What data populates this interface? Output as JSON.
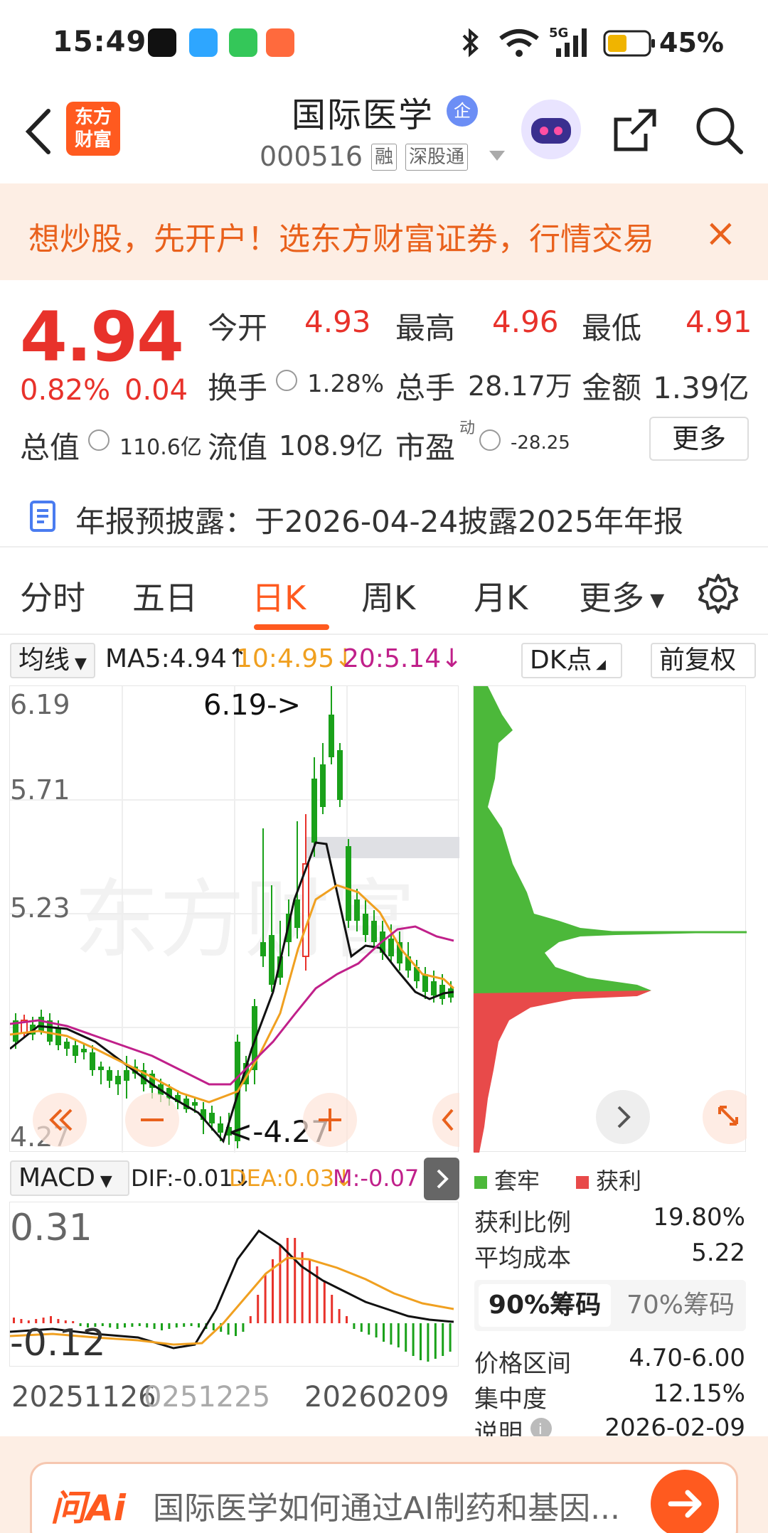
{
  "status_bar": {
    "time": "15:49",
    "battery": "45%"
  },
  "header": {
    "name": "国际医学",
    "badge": "企",
    "code": "000516",
    "tags": [
      "融",
      "深股通"
    ],
    "logo": "东方财富"
  },
  "banner": {
    "text": "想炒股，先开户！选东方财富证券，行情交易",
    "close": "×"
  },
  "quote": {
    "price": "4.94",
    "change_pct": "0.82%",
    "change": "0.04",
    "open_label": "今开",
    "open": "4.93",
    "high_label": "最高",
    "high": "4.96",
    "low_label": "最低",
    "low": "4.91",
    "turnover_label": "换手",
    "turnover": "1.28%",
    "volume_label": "总手",
    "volume": "28.17万",
    "amount_label": "金额",
    "amount": "1.39亿",
    "mktcap_label": "总值",
    "mktcap": "110.6亿",
    "float_label": "流值",
    "float": "108.9亿",
    "pe_label": "市盈",
    "pe_sup": "动",
    "pe": "-28.25",
    "more": "更多"
  },
  "notice": {
    "text": "年报预披露：于2026-04-24披露2025年年报"
  },
  "tabs": [
    "分时",
    "五日",
    "日K",
    "周K",
    "月K",
    "更多"
  ],
  "indicators": {
    "ma_select": "均线",
    "ma5": "MA5:4.94↑",
    "ma10": "10:4.95↓",
    "ma20": "20:5.14↓",
    "dk": "DK点",
    "adjust": "前复权",
    "macd_select": "MACD",
    "dif": "DIF:-0.01↓",
    "dea": "DEA:0.03↓",
    "m": "M:-0.07↑"
  },
  "colors": {
    "up": "#e8322b",
    "down": "#1aa11a",
    "accent": "#ff5a1f",
    "ma10": "#f0a020",
    "ma20": "#c0208a"
  },
  "kline_axis": {
    "y_labels": [
      "6.19",
      "5.71",
      "5.23",
      "4.27"
    ],
    "high_mark": "6.19->",
    "low_mark": "<-4.27"
  },
  "macd_axis": {
    "y_labels": [
      "0.31",
      "-0.12"
    ]
  },
  "dates": [
    "20251126",
    "0251225",
    "20260209"
  ],
  "chips": {
    "legend_trap": "套牢",
    "legend_profit": "获利",
    "profit_ratio_label": "获利比例",
    "profit_ratio": "19.80%",
    "avg_cost_label": "平均成本",
    "avg_cost": "5.22",
    "tab_90": "90%筹码",
    "tab_70": "70%筹码",
    "range_label": "价格区间",
    "range": "4.70-6.00",
    "concentration_label": "集中度",
    "concentration": "12.15%",
    "note_label": "说明",
    "note_date": "2026-02-09"
  },
  "ai_bar": {
    "logo": "问Ai",
    "placeholder": "国际医学如何通过AI制药和基因..."
  }
}
